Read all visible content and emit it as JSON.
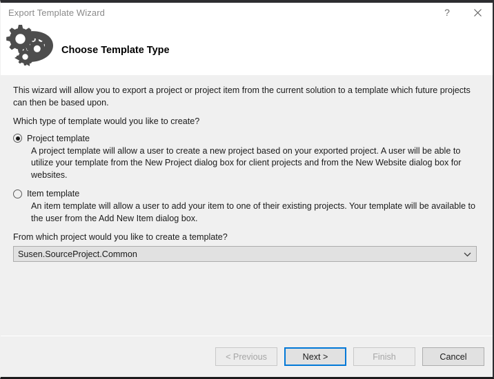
{
  "window": {
    "title": "Export Template Wizard",
    "help_glyph": "?",
    "close_glyph": "✕"
  },
  "header": {
    "heading": "Choose Template Type",
    "icon": "gears-arrow-icon"
  },
  "body": {
    "intro": "This wizard will allow you to export a project or project item from the current solution to a template which future projects can then be based upon.",
    "question": "Which type of template would you like to create?",
    "options": [
      {
        "label": "Project template",
        "selected": true,
        "description": "A project template will allow a user to create a new project based on your exported project. A user will be able to utilize your template from the New Project dialog box for client projects and from the New Website dialog box for websites."
      },
      {
        "label": "Item template",
        "selected": false,
        "description": "An item template will allow a user to add your item to one of their existing projects. Your template will be available to the user from the Add New Item dialog box."
      }
    ],
    "combo_label": "From which project would you like to create a template?",
    "combo_value": "Susen.SourceProject.Common",
    "combo_arrow_icon": "chevron-down-icon"
  },
  "footer": {
    "buttons": [
      {
        "label": "< Previous",
        "state": "disabled"
      },
      {
        "label": "Next >",
        "state": "focused"
      },
      {
        "label": "Finish",
        "state": "disabled"
      },
      {
        "label": "Cancel",
        "state": "normal"
      }
    ]
  },
  "colors": {
    "accent": "#0078d7",
    "titlebar_border": "#2d2d30",
    "body_background": "#f0f0f0",
    "control_fill": "#e1e1e1",
    "icon": "#4d4d4d"
  }
}
